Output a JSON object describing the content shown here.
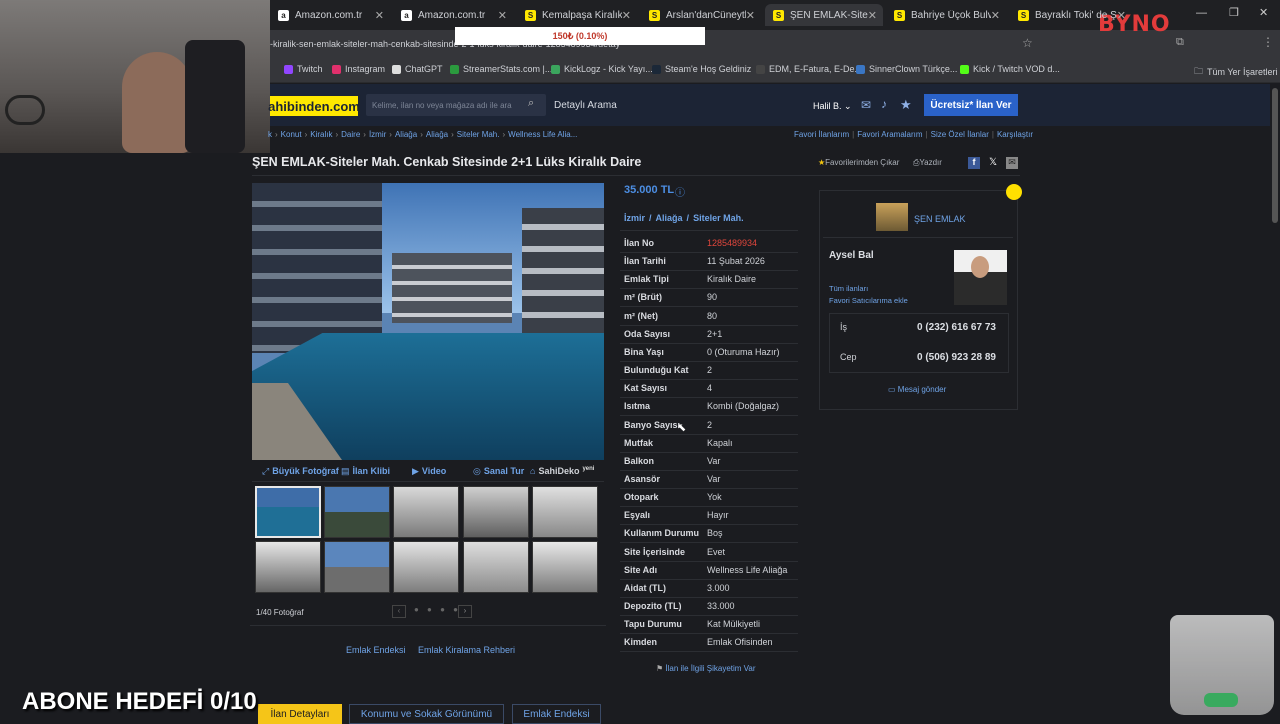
{
  "browser": {
    "tabs": [
      {
        "label": "Amazon.com.tr",
        "icon": "amazon-icon"
      },
      {
        "label": "Amazon.com.tr",
        "icon": "amazon-icon"
      },
      {
        "label": "Kemalpaşa Kiralık Re",
        "icon": "sahibinden-icon"
      },
      {
        "label": "Arslan'danCüneytbey",
        "icon": "sahibinden-icon"
      },
      {
        "label": "ŞEN EMLAK-Siteler M",
        "icon": "sahibinden-icon"
      },
      {
        "label": "Bahriye Üçok Bulvar",
        "icon": "sahibinden-icon"
      },
      {
        "label": "Bayraklı Toki' de Şeh",
        "icon": "sahibinden-icon"
      }
    ],
    "url": "-kiralik-sen-emlak-siteler-mah-cenkab-sitesinde-2-1-luks-kiralik-daire-1285489934/detay",
    "bookmarks": [
      "Twitch",
      "Instagram",
      "ChatGPT",
      "StreamerStats.com |...",
      "KickLogz - Kick Yayı...",
      "Steam'e Hoş Geldiniz",
      "EDM, E-Fatura, E-De...",
      "SinnerClown Türkçe...",
      "Kick / Twitch VOD d..."
    ],
    "all_bookmarks": "Tüm Yer İşaretleri"
  },
  "overlay": {
    "donation_text": "150₺ (0.10%)",
    "goal_text": "ABONE HEDEFİ 0/10",
    "logo": "BYNO"
  },
  "site": {
    "logo": "ahibinden.com",
    "search_placeholder": "Kelime, ilan no veya mağaza adı ile ara",
    "detailed_search": "Detaylı Arama",
    "user": "Halil B.",
    "post_button": "Ücretsiz* İlan Ver",
    "breadcrumb": [
      "k",
      "Konut",
      "Kiralık",
      "Daire",
      "İzmir",
      "Aliağa",
      "Aliağa",
      "Siteler Mah.",
      "Wellness Life Alia..."
    ],
    "top_links": [
      "Favori İlanlarım",
      "Favori Aramalarım",
      "Size Özel İlanlar",
      "Karşılaştır"
    ],
    "title": "ŞEN EMLAK-Siteler Mah. Cenkab Sitesinde 2+1 Lüks Kiralık Daire",
    "fav_remove": "Favorilerimden Çıkar",
    "print": "Yazdır",
    "price": "35.000 TL",
    "location": [
      "İzmir",
      "Aliağa",
      "Siteler Mah."
    ],
    "details": [
      [
        "İlan No",
        "1285489934"
      ],
      [
        "İlan Tarihi",
        "11 Şubat 2026"
      ],
      [
        "Emlak Tipi",
        "Kiralık Daire"
      ],
      [
        "m² (Brüt)",
        "90"
      ],
      [
        "m² (Net)",
        "80"
      ],
      [
        "Oda Sayısı",
        "2+1"
      ],
      [
        "Bina Yaşı",
        "0 (Oturuma Hazır)"
      ],
      [
        "Bulunduğu Kat",
        "2"
      ],
      [
        "Kat Sayısı",
        "4"
      ],
      [
        "Isıtma",
        "Kombi (Doğalgaz)"
      ],
      [
        "Banyo Sayısı",
        "2"
      ],
      [
        "Mutfak",
        "Kapalı"
      ],
      [
        "Balkon",
        "Var"
      ],
      [
        "Asansör",
        "Var"
      ],
      [
        "Otopark",
        "Yok"
      ],
      [
        "Eşyalı",
        "Hayır"
      ],
      [
        "Kullanım Durumu",
        "Boş"
      ],
      [
        "Site İçerisinde",
        "Evet"
      ],
      [
        "Site Adı",
        "Wellness Life Aliağa"
      ],
      [
        "Aidat (TL)",
        "3.000"
      ],
      [
        "Depozito (TL)",
        "33.000"
      ],
      [
        "Tapu Durumu",
        "Kat Mülkiyetli"
      ],
      [
        "Kimden",
        "Emlak Ofisinden"
      ]
    ],
    "complaint": "İlan ile İlgili Şikayetim Var",
    "photo_tabs": [
      "Büyük Fotoğraf",
      "İlan Klibi",
      "Video",
      "Sanal Tur",
      "SahiDeko"
    ],
    "photo_tab_badge": "yeni",
    "photo_count": "1/40 Fotoğraf",
    "bottom_links": [
      "Emlak Endeksi",
      "Emlak Kiralama Rehberi"
    ],
    "bottom_tabs": [
      "İlan Detayları",
      "Konumu ve Sokak Görünümü",
      "Emlak Endeksi"
    ],
    "seller": {
      "office": "ŞEN EMLAK",
      "agent": "Aysel Bal",
      "all_listings": "Tüm ilanları",
      "add_fav": "Favori Satıcılarıma ekle",
      "phones": [
        [
          "İş",
          "0 (232) 616 67 73"
        ],
        [
          "Cep",
          "0 (506) 923 28 89"
        ]
      ],
      "message": "Mesaj gönder"
    }
  }
}
